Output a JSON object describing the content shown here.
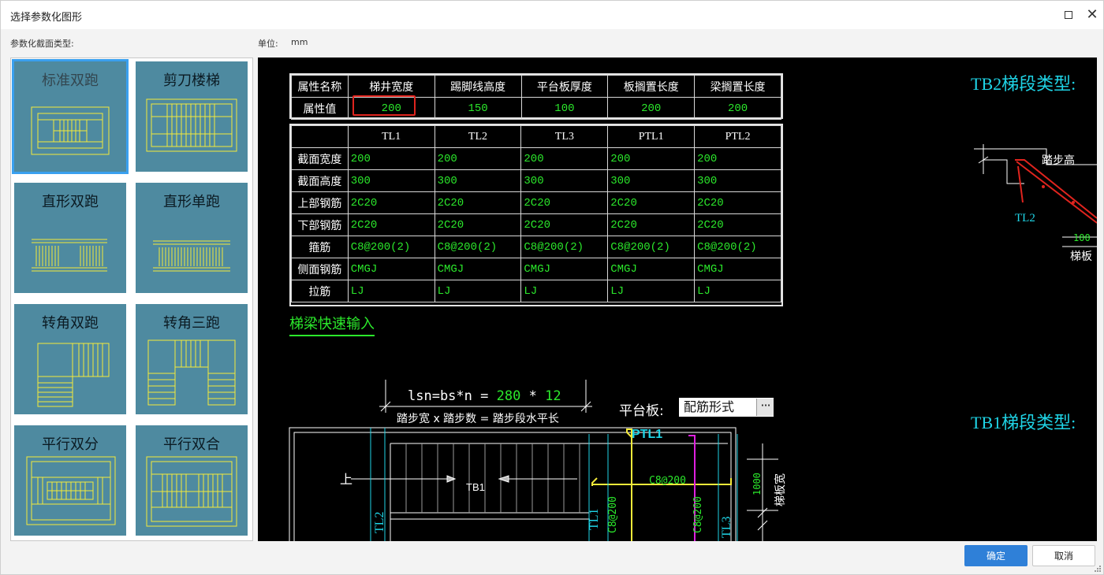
{
  "window": {
    "title": "选择参数化图形"
  },
  "labels": {
    "section_type": "参数化截面类型:",
    "unit_label": "单位:",
    "unit_value": "mm"
  },
  "thumbnails": [
    {
      "label": "标准双跑"
    },
    {
      "label": "剪刀楼梯"
    },
    {
      "label": "直形双跑"
    },
    {
      "label": "直形单跑"
    },
    {
      "label": "转角双跑"
    },
    {
      "label": "转角三跑"
    },
    {
      "label": "平行双分"
    },
    {
      "label": "平行双合"
    }
  ],
  "attr_table": {
    "headers": [
      "属性名称",
      "梯井宽度",
      "踢脚线高度",
      "平台板厚度",
      "板搁置长度",
      "梁搁置长度"
    ],
    "row_label": "属性值",
    "values": [
      "200",
      "150",
      "100",
      "200",
      "200"
    ]
  },
  "beam_table": {
    "columns": [
      "TL1",
      "TL2",
      "TL3",
      "PTL1",
      "PTL2"
    ],
    "rows": [
      {
        "label": "截面宽度",
        "values": [
          "200",
          "200",
          "200",
          "200",
          "200"
        ]
      },
      {
        "label": "截面高度",
        "values": [
          "300",
          "300",
          "300",
          "300",
          "300"
        ]
      },
      {
        "label": "上部钢筋",
        "values": [
          "2C20",
          "2C20",
          "2C20",
          "2C20",
          "2C20"
        ]
      },
      {
        "label": "下部钢筋",
        "values": [
          "2C20",
          "2C20",
          "2C20",
          "2C20",
          "2C20"
        ]
      },
      {
        "label": "箍筋",
        "values": [
          "C8@200(2)",
          "C8@200(2)",
          "C8@200(2)",
          "C8@200(2)",
          "C8@200(2)"
        ]
      },
      {
        "label": "侧面钢筋",
        "values": [
          "CMGJ",
          "CMGJ",
          "CMGJ",
          "CMGJ",
          "CMGJ"
        ]
      },
      {
        "label": "拉筋",
        "values": [
          "LJ",
          "LJ",
          "LJ",
          "LJ",
          "LJ"
        ]
      }
    ]
  },
  "quick_input": "梯梁快速输入",
  "formula": {
    "prefix": "lsn=bs",
    "star": "*",
    "n": "n =",
    "bs_value": "280",
    "n_value": "12",
    "caption": "踏步宽 x 踏步数 = 踏步段水平长"
  },
  "platform": {
    "label": "平台板:",
    "value": "配筋形式",
    "dots": "···"
  },
  "drawing": {
    "up": "上",
    "tb1": "TB1",
    "ptl1": "PTL1",
    "rebar_h": "C8@200",
    "rebar_v1": "C8@200",
    "rebar_v2": "C8@200",
    "tl2": "TL2",
    "tl1": "TL1",
    "tl3": "TL3",
    "dim_1000": "1000",
    "board_width": "梯板宽"
  },
  "right_side": {
    "tb2_title": "TB2梯段类型:",
    "tb1_title": "TB1梯段类型:",
    "step_height": "踏步高",
    "tl2": "TL2",
    "dim_100": "100",
    "board": "梯板"
  },
  "buttons": {
    "ok": "确定",
    "cancel": "取消"
  },
  "colors": {
    "cad_bg": "#000000",
    "green": "#2be82b",
    "cyan": "#1fd4e6",
    "yellow": "#f4ea3a",
    "magenta": "#e020e0",
    "red": "#e0241e",
    "accent": "#2f80d8"
  }
}
